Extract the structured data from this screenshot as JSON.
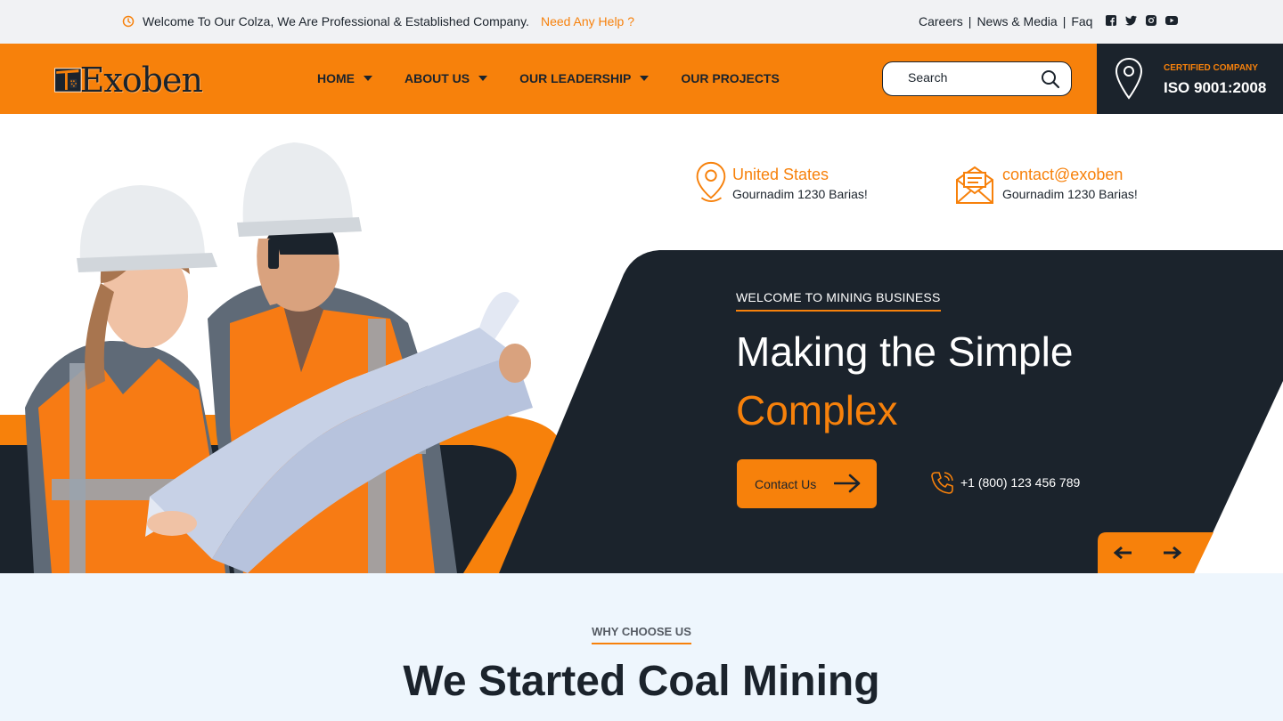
{
  "topbar": {
    "welcome_text": "Welcome To Our Colza, We Are Professional & Established Company.",
    "help_link": "Need Any Help ?",
    "links": [
      "Careers",
      "News & Media",
      "Faq"
    ],
    "separator": "|",
    "socials": [
      "facebook-icon",
      "twitter-icon",
      "instagram-icon",
      "youtube-icon"
    ]
  },
  "brand": {
    "name": "Exoben"
  },
  "nav": {
    "items": [
      {
        "label": "HOME",
        "dropdown": true
      },
      {
        "label": "ABOUT US",
        "dropdown": true
      },
      {
        "label": "OUR LEADERSHIP",
        "dropdown": true
      },
      {
        "label": "OUR PROJECTS",
        "dropdown": false
      }
    ]
  },
  "search": {
    "placeholder": "Search"
  },
  "certification": {
    "label": "CERTIFIED COMPANY",
    "value": "ISO 9001:2008"
  },
  "contact_info": [
    {
      "title": "United States",
      "subtitle": "Gournadim 1230 Barias!",
      "icon": "location-pin-icon"
    },
    {
      "title": "contact@exoben",
      "subtitle": "Gournadim 1230 Barias!",
      "icon": "mail-icon"
    }
  ],
  "hero": {
    "kicker": "WELCOME TO MINING BUSINESS",
    "headline_line1": "Making the Simple",
    "headline_line2": "Complex",
    "cta_label": "Contact Us",
    "phone": "+1 (800) 123 456 789"
  },
  "why": {
    "kicker": "WHY CHOOSE US",
    "title": "We Started Coal Mining"
  },
  "colors": {
    "accent": "#f7810b",
    "dark": "#1b232c",
    "topbar_bg": "#f1f2f4",
    "section_bg": "#eef6fd"
  }
}
